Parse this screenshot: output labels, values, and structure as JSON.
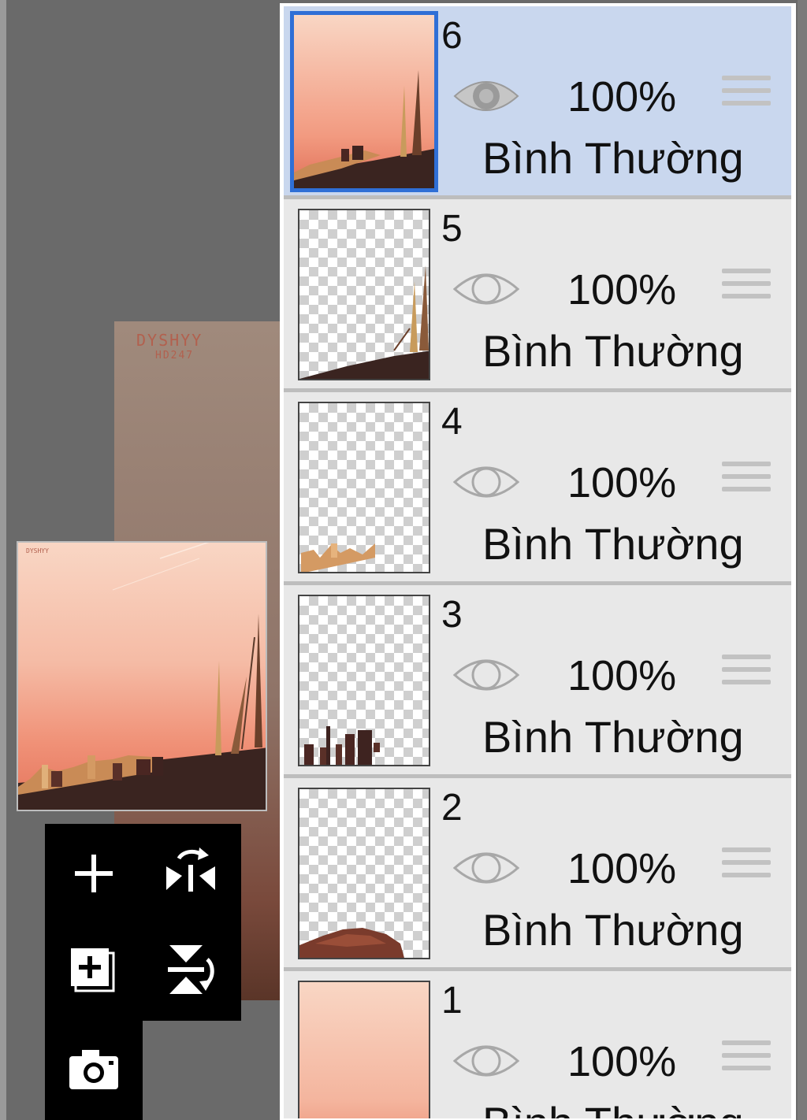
{
  "canvas": {
    "signature_line1": "DYSHYY",
    "signature_line2": "HD247",
    "preview_signature": "DYSHYY"
  },
  "tools": [
    {
      "name": "add-layer",
      "icon": "plus-icon"
    },
    {
      "name": "flip-horizontal",
      "icon": "flip-horizontal-icon"
    },
    {
      "name": "add-layer-copy",
      "icon": "layer-plus-icon"
    },
    {
      "name": "flip-vertical",
      "icon": "flip-vertical-icon"
    },
    {
      "name": "import-photo",
      "icon": "camera-icon"
    }
  ],
  "layers": [
    {
      "number": "6",
      "opacity": "100%",
      "blend_mode": "Bình Thường",
      "visible": true,
      "selected": true
    },
    {
      "number": "5",
      "opacity": "100%",
      "blend_mode": "Bình Thường",
      "visible": true,
      "selected": false
    },
    {
      "number": "4",
      "opacity": "100%",
      "blend_mode": "Bình Thường",
      "visible": true,
      "selected": false
    },
    {
      "number": "3",
      "opacity": "100%",
      "blend_mode": "Bình Thường",
      "visible": true,
      "selected": false
    },
    {
      "number": "2",
      "opacity": "100%",
      "blend_mode": "Bình Thường",
      "visible": true,
      "selected": false
    },
    {
      "number": "1",
      "opacity": "100%",
      "blend_mode": "Bình Thường",
      "visible": true,
      "selected": false
    }
  ],
  "colors": {
    "selected_row": "#c9d7ee",
    "row": "#e8e8e8",
    "selection_border": "#2f6fd6",
    "sky_light": "#f9d6c4",
    "sky_dark": "#e4745c"
  }
}
